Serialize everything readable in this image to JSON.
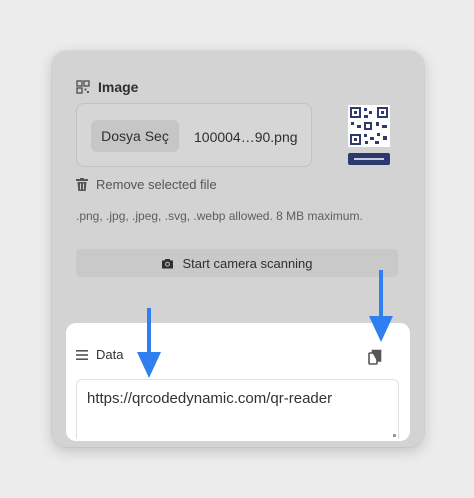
{
  "image_section": {
    "title": "Image",
    "file_button_label": "Dosya Seç",
    "file_name": "100004…90.png",
    "remove_label": "Remove selected file",
    "allowed_text": ".png, .jpg, .jpeg, .svg, .webp allowed. 8 MB maximum.",
    "camera_button_label": "Start camera scanning"
  },
  "data_section": {
    "title": "Data",
    "value": "https://qrcodedynamic.com/qr-reader"
  },
  "colors": {
    "arrow": "#2f7ff0",
    "card_bg": "#d3d3d3",
    "panel_bg": "#ffffff"
  }
}
